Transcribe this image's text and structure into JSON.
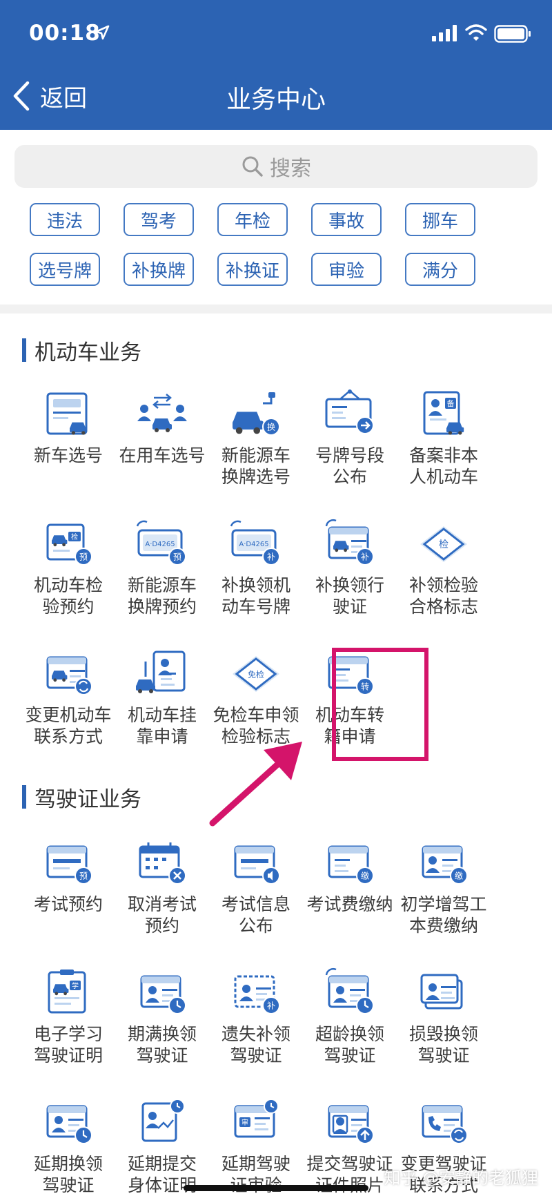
{
  "status": {
    "time": "00:18"
  },
  "nav": {
    "back": "返回",
    "title": "业务中心"
  },
  "search": {
    "placeholder": "搜索"
  },
  "tags": [
    "违法",
    "驾考",
    "年检",
    "事故",
    "挪车",
    "选号牌",
    "补换牌",
    "补换证",
    "审验",
    "满分"
  ],
  "sections": {
    "vehicle": {
      "title": "机动车业务",
      "items": [
        {
          "label": "新车选号",
          "icon": "plate-number-icon"
        },
        {
          "label": "在用车选号",
          "icon": "car-exchange-icon"
        },
        {
          "label": "新能源车\n换牌选号",
          "icon": "ev-car-icon",
          "badge": "换"
        },
        {
          "label": "号牌号段\n公布",
          "icon": "notice-board-icon"
        },
        {
          "label": "备案非本\n人机动车",
          "icon": "record-doc-icon",
          "badge": "备"
        },
        {
          "label": "机动车检\n验预约",
          "icon": "inspection-booking-icon",
          "badge": "预"
        },
        {
          "label": "新能源车\n换牌预约",
          "icon": "ev-plate-booking-icon",
          "badge": "预",
          "plate": "A·D4265"
        },
        {
          "label": "补换领机\n动车号牌",
          "icon": "plate-replace-icon",
          "badge": "补",
          "plate": "A·D4265"
        },
        {
          "label": "补换领行\n驶证",
          "icon": "license-replace-icon",
          "badge": "补"
        },
        {
          "label": "补领检验\n合格标志",
          "icon": "inspection-badge-icon",
          "badge": "检"
        },
        {
          "label": "变更机动车\n联系方式",
          "icon": "contact-change-icon"
        },
        {
          "label": "机动车挂\n靠申请",
          "icon": "affiliation-icon"
        },
        {
          "label": "免检车申领\n检验标志",
          "icon": "exempt-badge-icon",
          "badge": "免检"
        },
        {
          "label": "机动车转\n籍申请",
          "icon": "transfer-icon",
          "badge": "转"
        }
      ]
    },
    "license": {
      "title": "驾驶证业务",
      "items": [
        {
          "label": "考试预约",
          "icon": "exam-booking-icon",
          "badge": "预"
        },
        {
          "label": "取消考试\n预约",
          "icon": "cancel-calendar-icon"
        },
        {
          "label": "考试信息\n公布",
          "icon": "exam-info-icon"
        },
        {
          "label": "考试费缴纳",
          "icon": "exam-fee-icon",
          "badge": "缴"
        },
        {
          "label": "初学增驾工\n本费缴纳",
          "icon": "fee-card-icon",
          "badge": "缴"
        },
        {
          "label": "电子学习\n驾驶证明",
          "icon": "study-cert-icon",
          "badge": "学"
        },
        {
          "label": "期满换领\n驾驶证",
          "icon": "expiry-renew-icon"
        },
        {
          "label": "遗失补领\n驾驶证",
          "icon": "lost-replace-icon",
          "badge": "补"
        },
        {
          "label": "超龄换领\n驾驶证",
          "icon": "overage-renew-icon"
        },
        {
          "label": "损毁换领\n驾驶证",
          "icon": "damaged-renew-icon"
        },
        {
          "label": "延期换领\n驾驶证",
          "icon": "delay-renew-icon"
        },
        {
          "label": "延期提交\n身体证明",
          "icon": "delay-health-icon"
        },
        {
          "label": "延期驾驶\n证审验",
          "icon": "delay-review-icon",
          "badge": "审"
        },
        {
          "label": "提交驾驶证\n证件照片",
          "icon": "photo-submit-icon"
        },
        {
          "label": "变更驾驶证\n联系方式",
          "icon": "license-contact-icon"
        }
      ]
    }
  },
  "watermark": "知乎 @安静的老狐狸",
  "colors": {
    "header": "#2c63b3",
    "accent": "#4479c3",
    "highlight": "#d4146a"
  }
}
